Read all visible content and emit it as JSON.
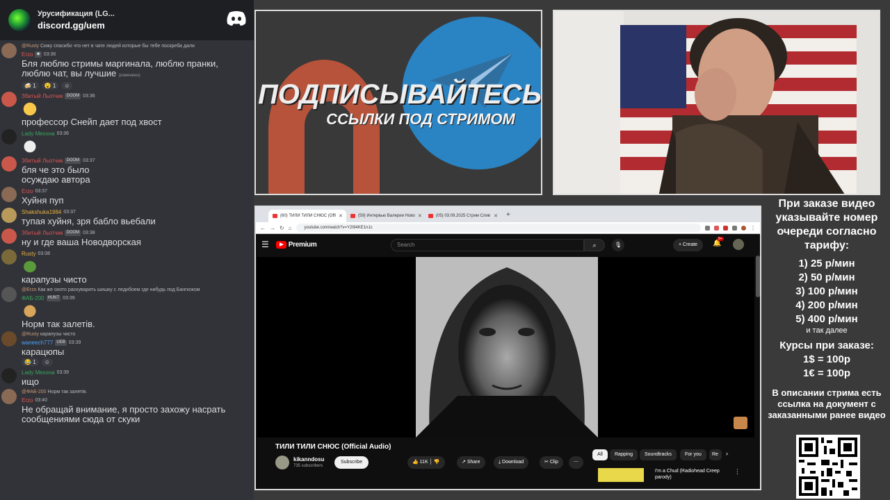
{
  "chat": {
    "title": "Урусификация (LG...",
    "subtitle": "discord.gg/uem",
    "messages": [
      {
        "reply": "Сижу спасибо что нет в чате людей которые бы тебе поскреба дали",
        "name": "Erzo",
        "time": "03:36",
        "text": "Бля люблю стримы маргинала, люблю пранки, люблю чат, вы лучшие",
        "edited": "(изменено)",
        "reactions": [
          "1",
          "1"
        ]
      },
      {
        "name": "Збитый Льотчик",
        "badge": "DOOM",
        "time": "03:36",
        "text": "профессор Снейп дает под хвост"
      },
      {
        "name": "Lady Mexxна",
        "time": "03:36",
        "text": ""
      },
      {
        "name": "Збитый Льотчик",
        "badge": "DOOM",
        "time": "03:37",
        "text": "бля че это было осуждаю автора"
      },
      {
        "name": "Erzo",
        "time": "03:37",
        "text": "Хуйня пуп"
      },
      {
        "name": "Shakshuka1984",
        "time": "03:37",
        "text": "тупая хуйня, зря бабло вьебали"
      },
      {
        "name": "Збитый Льотчик",
        "badge": "DOOM",
        "time": "03:38",
        "text": "ну и где ваша Новодворская"
      },
      {
        "name": "Rusty",
        "time": "03:38",
        "text": "карапузы чисто"
      },
      {
        "reply": "Как же охото раскуварить шишку с ледибоем где нибудь под Бангкоком",
        "name": "ФАБ-200",
        "badge": "HUNT",
        "time": "03:39",
        "text": "Норм так залетів."
      },
      {
        "reply": "карапузы чисто",
        "name": "waneech777",
        "badge": "UEB",
        "time": "03:39",
        "text": "карацюпы",
        "reactions": [
          "1"
        ]
      },
      {
        "name": "Lady Mexxна",
        "time": "03:39",
        "text": "ищо"
      },
      {
        "reply": "Норм так залетів.",
        "name": "Erzo",
        "time": "03:40",
        "text": "Не обращай внимание, я просто захожу насрать сообщениями сюда от скуки"
      }
    ]
  },
  "banner": {
    "line1": "ПОДПИСЫВАЙТЕСЬ",
    "line2": "ССЫЛКИ ПОД СТРИМОМ"
  },
  "browser": {
    "tabs": [
      "(60) ТИЛИ ТИЛИ СНЮС (Offi",
      "(59) Интервью Валерии Ново",
      "(05) 03.09.2025 Стрим Слив"
    ],
    "url": "youtube.com/watch?v=Y2I94KE1n1c",
    "brand": "Premium",
    "search_placeholder": "Search",
    "create_label": "Create",
    "notif_count": "9+",
    "video_title": "ТИЛИ ТИЛИ СНЮС (Official Audio)",
    "channel": "kikanndosu",
    "subs": "735 subscribers",
    "subscribe": "Subscribe",
    "likes": "11K",
    "share": "Share",
    "download": "Download",
    "clip": "Clip",
    "chips": [
      "All",
      "Rapping",
      "Soundtracks",
      "For you",
      "Re"
    ],
    "rec_title": "I'm a Chud (Radiohead Creep parody)"
  },
  "pricing": {
    "heading": "При заказе видео указывайте номер очереди согласно тарифу:",
    "tiers": [
      "1) 25 р/мин",
      "2) 50 р/мин",
      "3) 100 р/мин",
      "4) 200 р/мин",
      "5) 400 р/мин"
    ],
    "more": "и так далее",
    "rates_title": "Курсы при заказе:",
    "rate1": "1$ = 100р",
    "rate2": "1€ = 100р",
    "desc": "В описании стрима есть ссылка на документ с заказанными ранее видео"
  }
}
